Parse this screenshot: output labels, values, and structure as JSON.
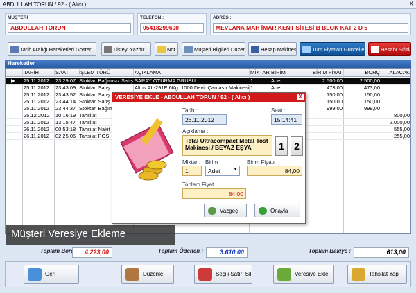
{
  "window": {
    "title": "ABDULLAH TORUN / 92 - ( Alıcı )",
    "close": "X"
  },
  "info": {
    "musteri": {
      "label": "MÜŞTERİ",
      "value": "ABDULLAH TORUN"
    },
    "telefon": {
      "label": "TELEFON :",
      "value": "05418299600"
    },
    "adres": {
      "label": "ADRES :",
      "value": "MEVLANA MAH İMAR KENT SİTESİ B BLOK KAT 2 D 5"
    }
  },
  "toolbar": {
    "tarih": "Tarih Aralığı Hareketleri Göster",
    "yazdir": "Listeyi Yazdır",
    "not": "Not",
    "musteri": "Müşteri Bilgileri Düzenle",
    "hesap": "Hesap Makinesi",
    "fiyat": "Tüm Fiyatları Güncelle",
    "sifirla": "Hesabı Sıfırla"
  },
  "section_title": "Hareketler",
  "grid": {
    "headers": [
      "TARİH",
      "SAAT",
      "İŞLEM TÜRÜ",
      "AÇIKLAMA",
      "MİKTAR",
      "BİRİM",
      "BİRİM FİYAT",
      "BORÇ",
      "ALACAK"
    ],
    "rows": [
      {
        "tarih": "25.11.2012",
        "saat": "23:29:07",
        "tur": "Stoktan Bağımsız Satış",
        "aciklama": "SARAY OTURMA GRUBU",
        "miktar": "1",
        "birim": "Adet",
        "fiyat": "2.500,00",
        "borc": "2.500,00",
        "alacak": "",
        "selected": true
      },
      {
        "tarih": "25.11.2012",
        "saat": "23:43:09",
        "tur": "Stoktan Satış",
        "aciklama": "Altus AL-291E 6Kg. 1000 Devir Çamaşır Makinesi",
        "miktar": "1",
        "birim": "Adet",
        "fiyat": "473,00",
        "borc": "473,00",
        "alacak": ""
      },
      {
        "tarih": "25.11.2012",
        "saat": "23:43:52",
        "tur": "Stoktan Satış",
        "aciklama": "",
        "miktar": "",
        "birim": "",
        "fiyat": "150,00",
        "borc": "150,00",
        "alacak": ""
      },
      {
        "tarih": "25.11.2012",
        "saat": "23:44:14",
        "tur": "Stoktan Satış",
        "aciklama": "",
        "miktar": "",
        "birim": "",
        "fiyat": "150,00",
        "borc": "150,00",
        "alacak": ""
      },
      {
        "tarih": "25.11.2012",
        "saat": "23:44:37",
        "tur": "Stoktan Bağım",
        "aciklama": "",
        "miktar": "",
        "birim": "",
        "fiyat": "999,00",
        "borc": "999,00",
        "alacak": ""
      },
      {
        "tarih": "25.12.2012",
        "saat": "10:16:19",
        "tur": "Tahsilat",
        "aciklama": "",
        "miktar": "",
        "birim": "",
        "fiyat": "",
        "borc": "",
        "alacak": "800,00"
      },
      {
        "tarih": "25.11.2012",
        "saat": "13:15:47",
        "tur": "Tahsilat",
        "aciklama": "",
        "miktar": "",
        "birim": "",
        "fiyat": "",
        "borc": "",
        "alacak": "2.000,00"
      },
      {
        "tarih": "26.11.2012",
        "saat": "00:53:18",
        "tur": "Tahsilat Nakit",
        "aciklama": "",
        "miktar": "",
        "birim": "",
        "fiyat": "",
        "borc": "",
        "alacak": "555,00"
      },
      {
        "tarih": "26.11.2012",
        "saat": "02:25:06",
        "tur": "Tahsilat POS",
        "aciklama": "",
        "miktar": "",
        "birim": "",
        "fiyat": "",
        "borc": "",
        "alacak": "255,00"
      }
    ]
  },
  "banner": "Müşteri Veresiye Ekleme",
  "totals": {
    "borc_label": "Toplam Borç:",
    "borc": "4.223,00",
    "odenen_label": "Toplam Ödenen :",
    "odenen": "3.610,00",
    "bakiye_label": "Toplam Bakiye :",
    "bakiye": "613,00"
  },
  "bottom": {
    "geri": "Geri",
    "duzenle": "Düzenle",
    "sil": "Seçili Satırı Sil",
    "veresiye": "Veresiye Ekle",
    "tahsilat": "Tahsilat Yap"
  },
  "dialog": {
    "title": "VERESİYE EKLE - ABDULLAH TORUN / 92 - ( Alıcı )",
    "close": "X",
    "tarih_label": "Tarih :",
    "tarih": "26.11.2012",
    "saat_label": "Saat :",
    "saat": "15:14:41",
    "aciklama_label": "Açıklama :",
    "aciklama": "Tefal Ultracompact Metal Tost Makinesi / BEYAZ EŞYA",
    "btn1": "1",
    "btn2": "2",
    "miktar_label": "Miktar :",
    "miktar": "1",
    "birim_label": "Birim :",
    "birim": "Adet",
    "birim_fiyat_label": "Birim Fiyatı :",
    "birim_fiyat": "84,00",
    "toplam_label": "Toplam Fiyat :",
    "toplam": "84,00",
    "vazgec": "Vazgeç",
    "onayla": "Onayla"
  }
}
